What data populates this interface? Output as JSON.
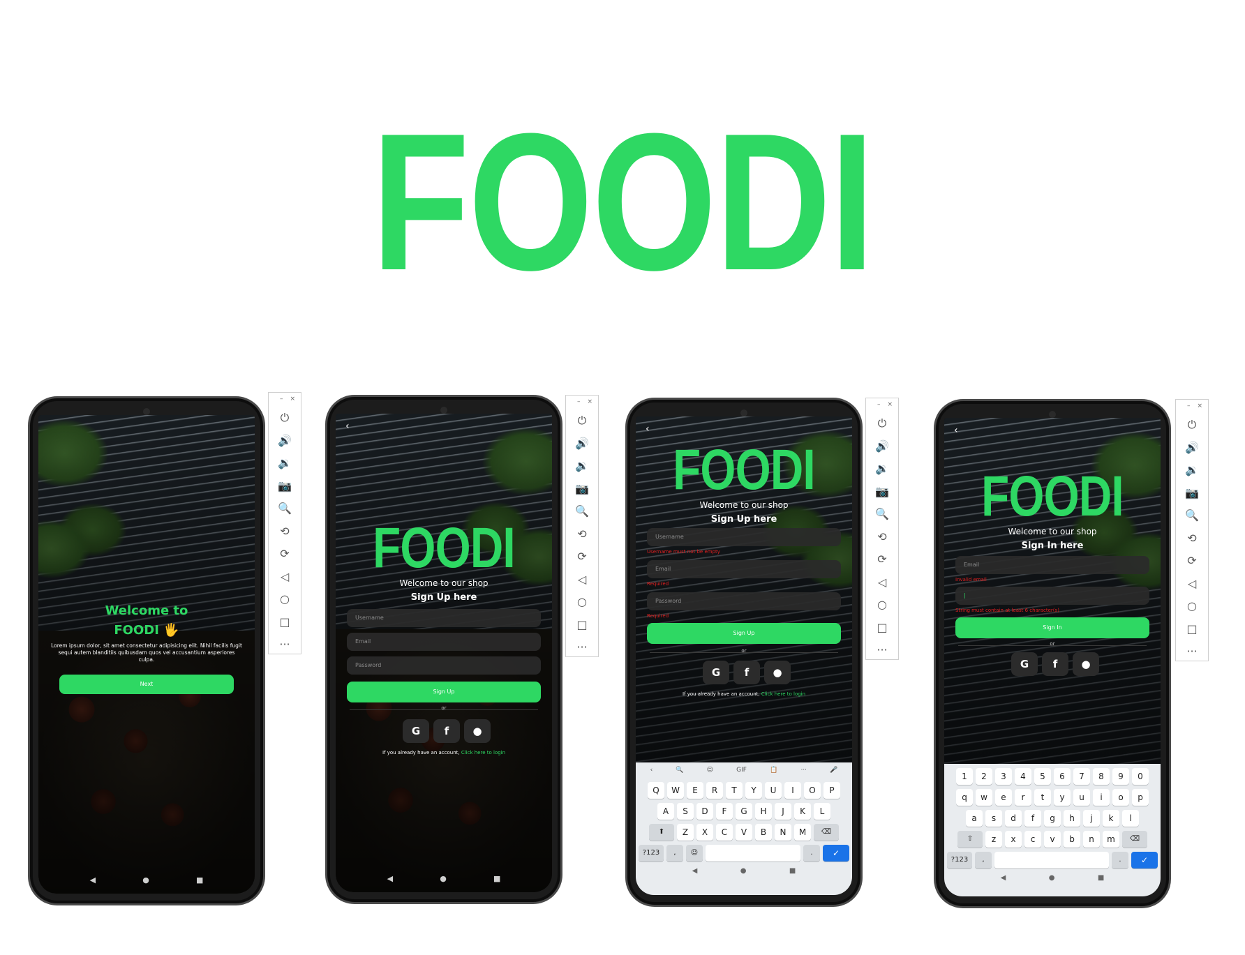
{
  "title": "FOODI",
  "colors": {
    "brand": "#2ed863",
    "error": "#e02020",
    "field_bg": "#2a2a2a"
  },
  "toolbar": {
    "minimize": "–",
    "close": "×",
    "icons": [
      "⏻",
      "🔊",
      "🔉",
      "📷",
      "🔍",
      "⟲",
      "⟳",
      "◁",
      "○",
      "□",
      "···"
    ]
  },
  "nav": {
    "back": "◀",
    "home": "●",
    "recents": "■"
  },
  "screen1": {
    "heading_line1": "Welcome to",
    "heading_line2": "FOODI 🖐",
    "body": "Lorem ipsum dolor, sit amet consectetur adipisicing elit. Nihil facilis fugit sequi autem blanditiis quibusdam quos vel accusantium asperiores culpa.",
    "next_button": "Next"
  },
  "screen2": {
    "back": "‹",
    "logo": "FOODI",
    "welcome": "Welcome to our shop",
    "subtitle": "Sign Up here",
    "username_placeholder": "Username",
    "email_placeholder": "Email",
    "password_placeholder": "Password",
    "signup_button": "Sign Up",
    "or": "or",
    "social": [
      "G",
      "f",
      ""
    ],
    "already_text": "If you already have an account,",
    "login_link": "Click here to login"
  },
  "screen3": {
    "back": "‹",
    "logo": "FOODI",
    "welcome": "Welcome to our shop",
    "subtitle": "Sign Up here",
    "username_placeholder": "Username",
    "username_error": "Username must not be empty",
    "email_placeholder": "Email",
    "email_error": "Required",
    "password_placeholder": "Password",
    "password_error": "Required",
    "signup_button": "Sign Up",
    "or": "or",
    "social": [
      "G",
      "f",
      ""
    ],
    "already_text": "If you already have an account,",
    "login_link": "Click here to login",
    "keyboard": {
      "strip": [
        "‹",
        "🔍",
        "☺",
        "GIF",
        "📋",
        "···",
        "🎤"
      ],
      "row1": [
        "Q",
        "W",
        "E",
        "R",
        "T",
        "Y",
        "U",
        "I",
        "O",
        "P"
      ],
      "row2": [
        "A",
        "S",
        "D",
        "F",
        "G",
        "H",
        "J",
        "K",
        "L"
      ],
      "row3": [
        "Z",
        "X",
        "C",
        "V",
        "B",
        "N",
        "M"
      ],
      "shift": "⬆",
      "backspace": "⌫",
      "sym": "?123",
      "comma": ",",
      "emoji": "☺",
      "period": ".",
      "enter": "✓"
    }
  },
  "screen4": {
    "back": "‹",
    "logo": "FOODI",
    "welcome": "Welcome to our shop",
    "subtitle": "Sign In here",
    "email_placeholder": "Email",
    "email_error": "Invalid email",
    "password_value": "|",
    "password_error": "String must contain at least 6 character(s)",
    "signin_button": "Sign In",
    "or": "or",
    "social": [
      "G",
      "f",
      ""
    ],
    "keyboard": {
      "row0": [
        "1",
        "2",
        "3",
        "4",
        "5",
        "6",
        "7",
        "8",
        "9",
        "0"
      ],
      "row1": [
        "q",
        "w",
        "e",
        "r",
        "t",
        "y",
        "u",
        "i",
        "o",
        "p"
      ],
      "row2": [
        "a",
        "s",
        "d",
        "f",
        "g",
        "h",
        "j",
        "k",
        "l"
      ],
      "row3": [
        "z",
        "x",
        "c",
        "v",
        "b",
        "n",
        "m"
      ],
      "shift": "⇧",
      "backspace": "⌫",
      "sym": "?123",
      "comma": ",",
      "period": ".",
      "enter": "✓"
    }
  }
}
